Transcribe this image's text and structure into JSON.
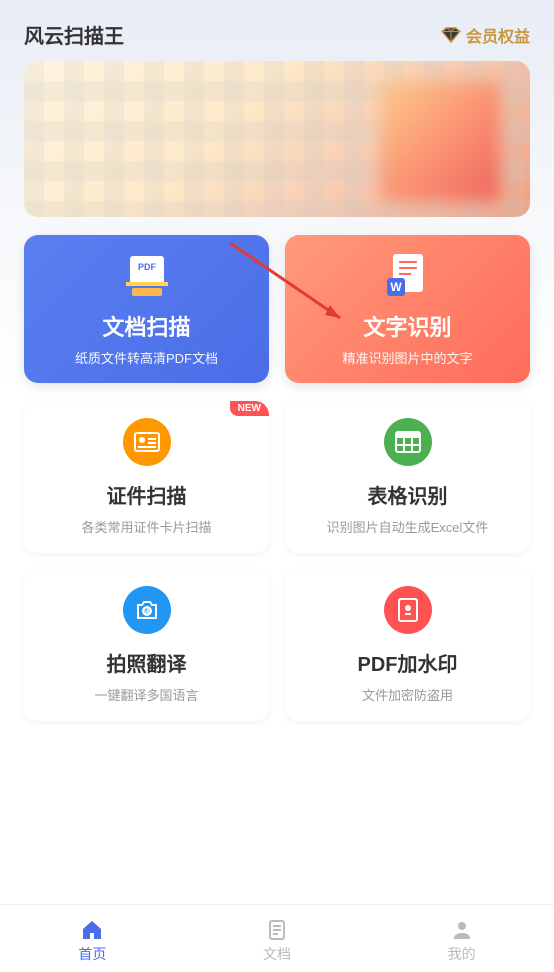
{
  "header": {
    "app_title": "风云扫描王",
    "vip_label": "会员权益"
  },
  "main_cards": [
    {
      "title": "文档扫描",
      "desc": "纸质文件转高清PDF文档",
      "icon": "pdf-scan-icon",
      "icon_label": "PDF"
    },
    {
      "title": "文字识别",
      "desc": "精准识别图片中的文字",
      "icon": "word-doc-icon",
      "icon_label": "W"
    }
  ],
  "secondary_cards": [
    {
      "title": "证件扫描",
      "desc": "各类常用证件卡片扫描",
      "icon": "id-card-icon",
      "badge": "NEW"
    },
    {
      "title": "表格识别",
      "desc": "识别图片自动生成Excel文件",
      "icon": "table-icon"
    },
    {
      "title": "拍照翻译",
      "desc": "一键翻译多国语言",
      "icon": "camera-translate-icon"
    },
    {
      "title": "PDF加水印",
      "desc": "文件加密防盗用",
      "icon": "pdf-watermark-icon"
    }
  ],
  "tabs": [
    {
      "label": "首页",
      "icon": "home-icon",
      "active": true
    },
    {
      "label": "文档",
      "icon": "docs-icon",
      "active": false
    },
    {
      "label": "我的",
      "icon": "profile-icon",
      "active": false
    }
  ],
  "colors": {
    "primary_blue": "#4a6de8",
    "primary_orange": "#ff6b5a",
    "vip_gold": "#c8973f"
  }
}
